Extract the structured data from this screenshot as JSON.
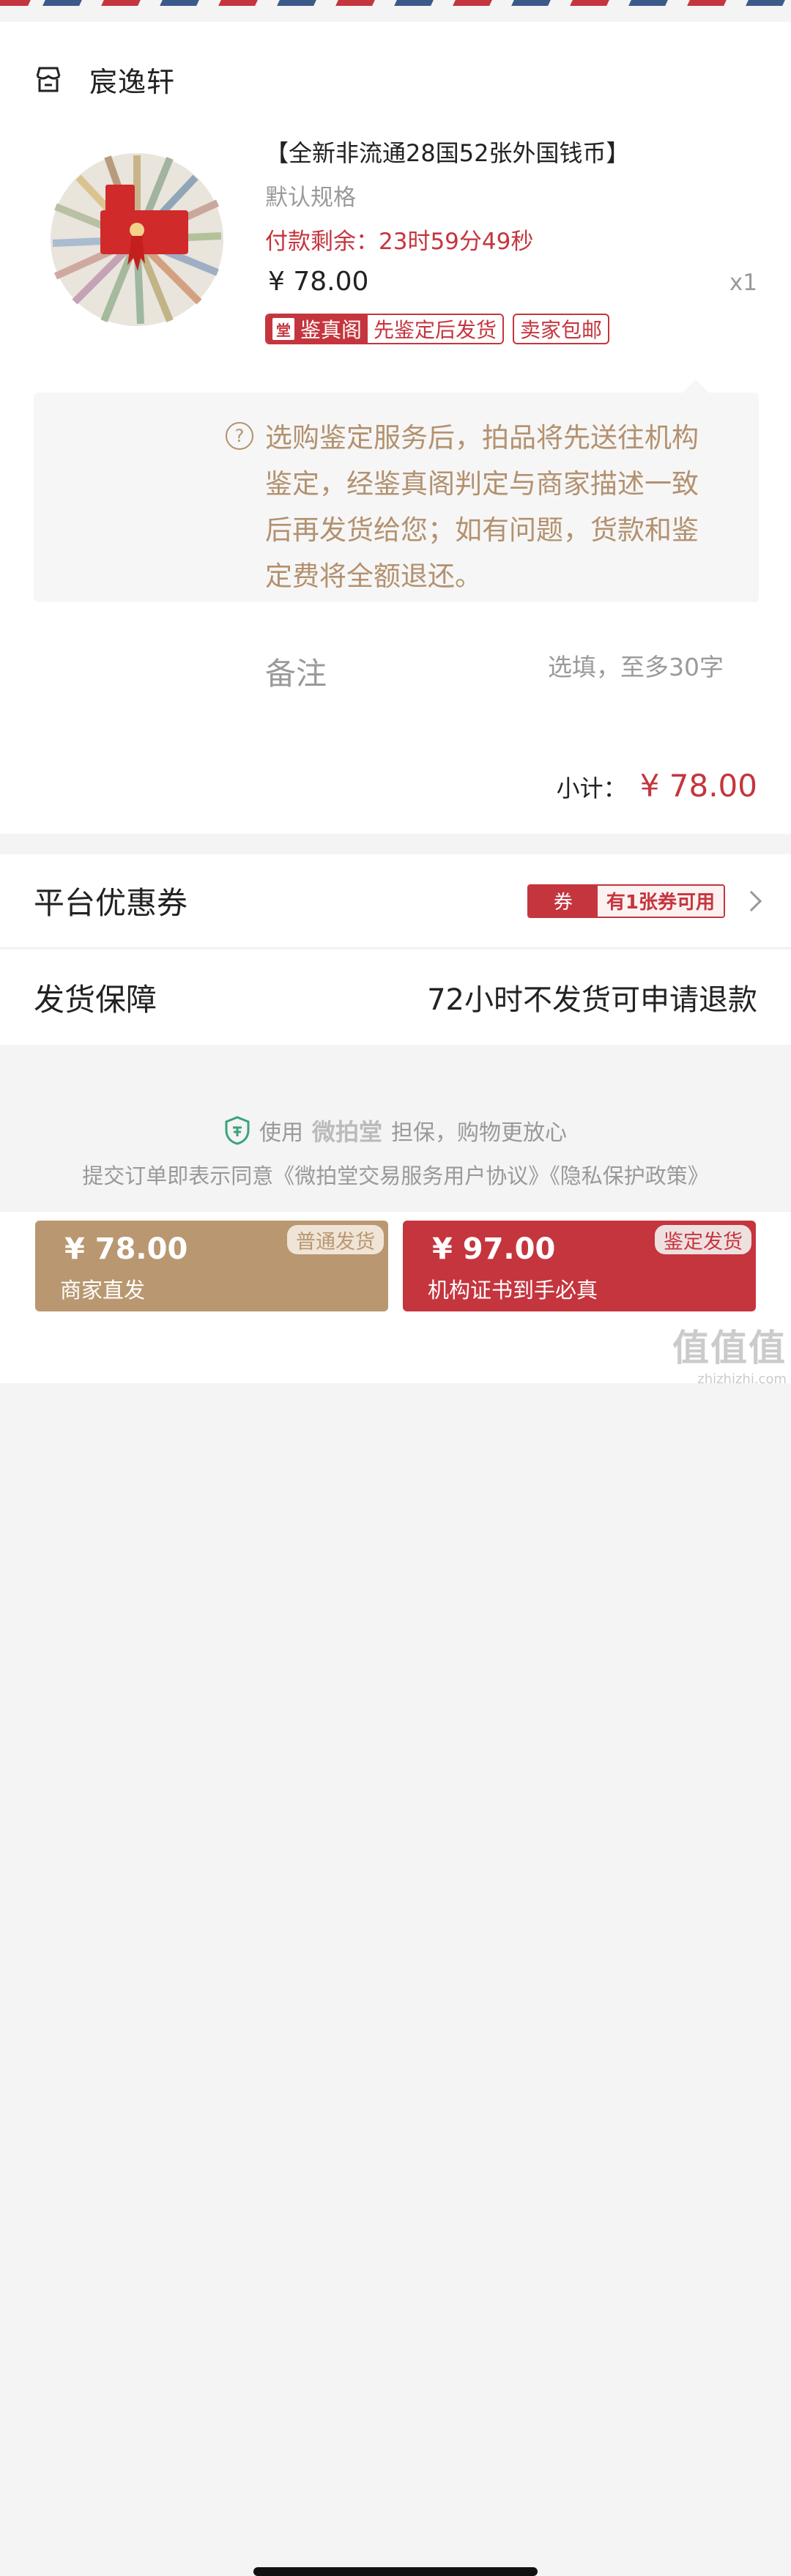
{
  "shop": {
    "name": "宸逸轩",
    "icon": "shop-icon"
  },
  "product": {
    "title": "【全新非流通28国52张外国钱币】",
    "spec": "默认规格",
    "pay_remaining": "付款剩余：23时59分49秒",
    "price": "¥ 78.00",
    "qty": "x1",
    "badge_jzg_brand": "鉴真阁",
    "badge_jzg_desc": "先鉴定后发货",
    "badge_free_ship": "卖家包邮"
  },
  "tip": {
    "icon": "help-circle-icon",
    "text": "选购鉴定服务后，拍品将先送往机构鉴定，经鉴真阁判定与商家描述一致后再发货给您；如有问题，货款和鉴定费将全额退还。"
  },
  "remark": {
    "label": "备注",
    "placeholder": "选填，至多30字"
  },
  "subtotal": {
    "label": "小计：",
    "value": "¥ 78.00"
  },
  "coupon": {
    "label": "平台优惠券",
    "tag": "券",
    "available": "有1张券可用"
  },
  "shipping": {
    "label": "发货保障",
    "value": "72小时不发货可申请退款"
  },
  "guarantee": {
    "prefix": "使用",
    "brand": "微拍堂",
    "suffix": "担保，购物更放心"
  },
  "agreement": "提交订单即表示同意《微拍堂交易服务用户协议》《隐私保护政策》",
  "buttons": {
    "normal": {
      "price": "¥ 78.00",
      "desc": "商家直发",
      "tag": "普通发货"
    },
    "auth": {
      "price": "¥ 97.00",
      "desc": "机构证书到手必真",
      "tag": "鉴定发货"
    }
  },
  "watermark": {
    "big": "值值值",
    "small": "zhizhizhi.com"
  },
  "colors": {
    "accent_red": "#c5353e",
    "gold": "#b99770",
    "tip_text": "#b3916f"
  }
}
